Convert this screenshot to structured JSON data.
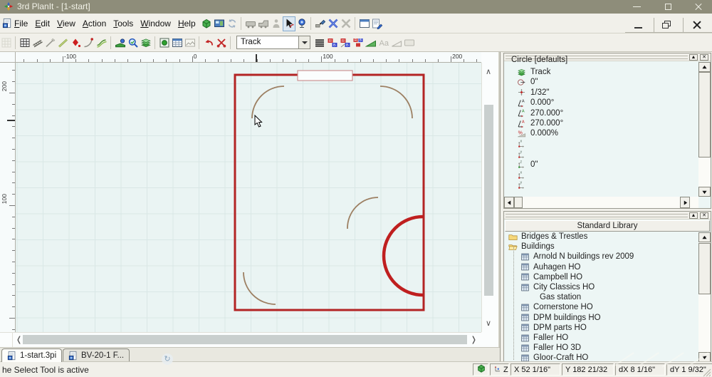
{
  "window": {
    "title": "3rd PlanIt - [1-start]"
  },
  "menubar": {
    "items": [
      {
        "label": "File"
      },
      {
        "label": "Edit"
      },
      {
        "label": "View"
      },
      {
        "label": "Action"
      },
      {
        "label": "Tools"
      },
      {
        "label": "Window"
      },
      {
        "label": "Help"
      }
    ]
  },
  "toolbar_main": {
    "items": [
      {
        "icon": "cube-3d"
      },
      {
        "icon": "train-view"
      },
      {
        "icon": "refresh",
        "state": "disabled"
      },
      {
        "sep": true
      },
      {
        "icon": "train-car",
        "state": "disabled"
      },
      {
        "icon": "locomotive",
        "state": "disabled"
      },
      {
        "icon": "passenger",
        "state": "disabled"
      },
      {
        "icon": "select-pointer",
        "state": "selected"
      },
      {
        "icon": "camera"
      },
      {
        "sep": true
      },
      {
        "icon": "uncouple"
      },
      {
        "icon": "cross-blue"
      },
      {
        "icon": "cross-gray",
        "state": "disabled"
      },
      {
        "sep": true
      },
      {
        "icon": "window-view"
      },
      {
        "icon": "edit-list"
      }
    ]
  },
  "toolbar_draw": {
    "combo_value": "Track",
    "items": [
      {
        "icon": "grid-faint",
        "state": "disabled"
      },
      {
        "sep": true
      },
      {
        "icon": "grid"
      },
      {
        "icon": "track-ties"
      },
      {
        "icon": "line-gray"
      },
      {
        "icon": "line-green"
      },
      {
        "icon": "endpoint-diamond"
      },
      {
        "icon": "curve-tool"
      },
      {
        "icon": "flex-track"
      },
      {
        "sep": true
      },
      {
        "icon": "turnout"
      },
      {
        "icon": "find-part"
      },
      {
        "icon": "layers"
      },
      {
        "sep": true
      },
      {
        "icon": "signal"
      },
      {
        "icon": "parts-table"
      },
      {
        "icon": "image-view",
        "state": "disabled"
      },
      {
        "sep": true
      },
      {
        "icon": "undo-red"
      },
      {
        "icon": "cut-red"
      },
      {
        "sep": true
      },
      {
        "combo": true
      },
      {
        "icon": "line-weight"
      },
      {
        "icon": "rail-rb-1"
      },
      {
        "icon": "rail-rb-2"
      },
      {
        "icon": "rail-rb-3"
      },
      {
        "icon": "grade-ramp"
      },
      {
        "icon": "text-aa",
        "state": "disabled"
      },
      {
        "icon": "grade-gray",
        "state": "disabled"
      },
      {
        "icon": "button-gray",
        "state": "disabled"
      }
    ]
  },
  "rulers": {
    "horizontal_labels": [
      "-100",
      "0",
      "100",
      "200"
    ],
    "vertical_labels": [
      "200",
      "100"
    ]
  },
  "properties_panel": {
    "title": "Circle [defaults]",
    "items": [
      {
        "icon": "layers",
        "value": "Track"
      },
      {
        "icon": "radius",
        "value": "0\""
      },
      {
        "icon": "offset",
        "value": "1/32\""
      },
      {
        "icon": "angle",
        "value": "0.000°"
      },
      {
        "icon": "angle-green",
        "value": "270.000°"
      },
      {
        "icon": "angle-red",
        "value": "270.000°"
      },
      {
        "icon": "grade-percent",
        "value": "0.000%"
      },
      {
        "icon": "x-axis",
        "value": ""
      },
      {
        "icon": "y-axis",
        "value": ""
      },
      {
        "icon": "z-axis",
        "value": "0\""
      },
      {
        "icon": "x-axis",
        "value": ""
      },
      {
        "icon": "y-axis",
        "value": ""
      }
    ]
  },
  "library_panel": {
    "header": "Standard Library",
    "tree": [
      {
        "icon": "folder",
        "label": "Bridges & Trestles",
        "level": 0
      },
      {
        "icon": "folder-open",
        "label": "Buildings",
        "level": 0
      },
      {
        "icon": "building",
        "label": "Arnold N buildings rev 2009",
        "level": 1
      },
      {
        "icon": "building",
        "label": "Auhagen HO",
        "level": 1
      },
      {
        "icon": "building",
        "label": "Campbell HO",
        "level": 1
      },
      {
        "icon": "building",
        "label": "City Classics HO",
        "level": 1
      },
      {
        "icon": "none",
        "label": "Gas station",
        "level": 2
      },
      {
        "icon": "building",
        "label": "Cornerstone HO",
        "level": 1
      },
      {
        "icon": "building",
        "label": "DPM buildings HO",
        "level": 1
      },
      {
        "icon": "building",
        "label": "DPM parts HO",
        "level": 1
      },
      {
        "icon": "building",
        "label": "Faller HO",
        "level": 1
      },
      {
        "icon": "building",
        "label": "Faller HO 3D",
        "level": 1
      },
      {
        "icon": "building",
        "label": "Gloor-Craft HO",
        "level": 1
      }
    ]
  },
  "tabs": [
    {
      "label": "1-start.3pi",
      "active": true
    },
    {
      "label": "BV-20-1 F...",
      "active": false
    }
  ],
  "statusbar": {
    "message": "he Select Tool is active",
    "mode_label": "Z",
    "coords": [
      "X 52 1/16\"",
      "Y 182 21/32",
      "dX 8 1/16\"",
      "dY 1 9/32\""
    ]
  }
}
